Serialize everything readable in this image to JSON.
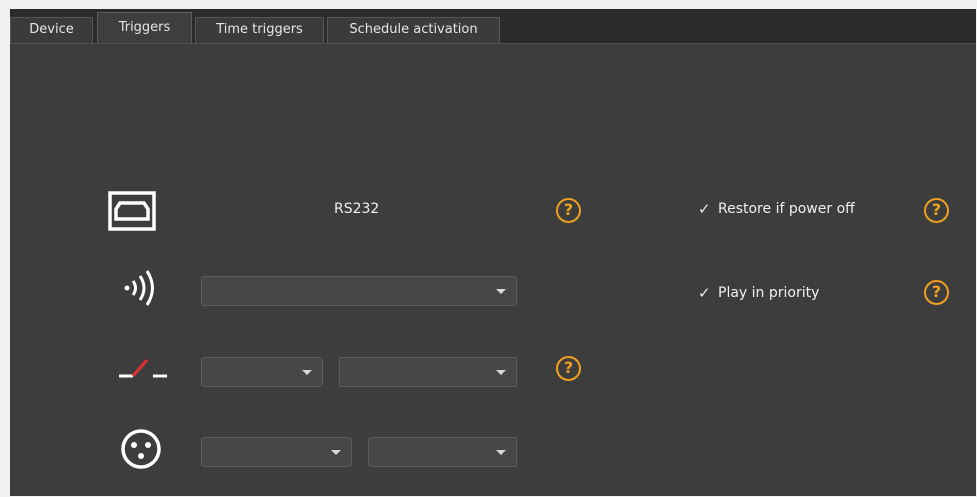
{
  "tabs": [
    {
      "label": "Device"
    },
    {
      "label": "Triggers",
      "active": true
    },
    {
      "label": "Time triggers"
    },
    {
      "label": "Schedule activation"
    }
  ],
  "help_glyph": "?",
  "rows": {
    "rs232": {
      "icon": "serial-port-icon",
      "label": "RS232"
    },
    "wireless": {
      "icon": "wireless-signal-icon",
      "select_value": ""
    },
    "contact": {
      "icon": "contact-switch-icon",
      "select1_value": "",
      "select2_value": ""
    },
    "dmx": {
      "icon": "xlr-connector-icon",
      "select1_value": "",
      "select2_value": ""
    }
  },
  "options": {
    "restore_if_power_off": {
      "label": "Restore if power off",
      "checked": true,
      "glyph": "✓"
    },
    "play_in_priority": {
      "label": "Play in priority",
      "checked": true,
      "glyph": "✓"
    }
  },
  "colors": {
    "accent": "#f0a020",
    "panel": "#3d3d3d",
    "contact_red": "#e03030"
  }
}
